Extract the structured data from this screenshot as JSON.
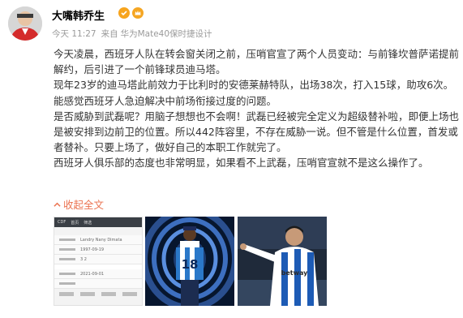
{
  "user": {
    "name": "大嘴韩乔生"
  },
  "meta": {
    "time": "今天 11:27",
    "source_prefix": "来自",
    "device": "华为Mate40保时捷设计"
  },
  "post": {
    "paragraphs": [
      "今天凌晨，西班牙人队在转会窗关闭之前，压哨官宣了两个人员变动：与前锋坎普萨诺提前解约，后引进了一个前锋球员迪马塔。",
      "现年23岁的迪马塔此前效力于比利时的安德莱赫特队，出场38次，打入15球，助攻6次。能感觉西班牙人急迫解决中前场衔接过度的问题。",
      "是否威胁到武磊呢？用脑子想想也不会啊！武磊已经被完全定义为超级替补啦，即便上场也是被安排到边前卫的位置。所以442阵容里，不存在威胁一说。但不管是什么位置，首发或者替补。只要上场了，做好自己的本职工作就完了。",
      "西班牙人俱乐部的态度也非常明显，如果看不上武磊，压哨官宣就不是这么操作了。"
    ]
  },
  "expand_label": "收起全文",
  "photos": {
    "doc": {
      "header": [
        "CDF",
        "首页",
        "筛选"
      ],
      "rows": [
        "Landry Nany Dimata",
        "1997-09-19",
        "3 2",
        "2021-09-01"
      ]
    },
    "jersey_number": "18",
    "sponsor": "betway"
  },
  "colors": {
    "link": "#eb7350",
    "meta": "#9a9a9a",
    "text": "#333333"
  }
}
